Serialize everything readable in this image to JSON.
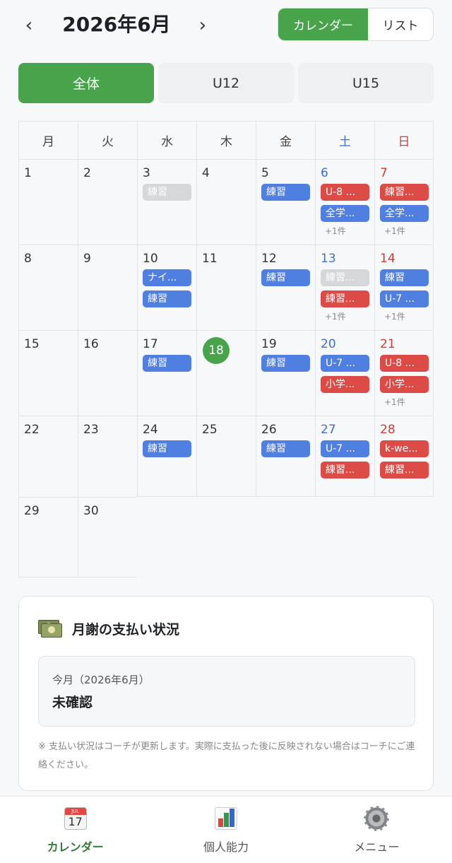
{
  "header": {
    "prev_symbol": "‹",
    "next_symbol": "›",
    "month_title": "2026年6月",
    "view_toggle": {
      "calendar": "カレンダー",
      "list": "リスト",
      "selected": "calendar"
    }
  },
  "tabs": [
    {
      "label": "全体",
      "active": true
    },
    {
      "label": "U12",
      "active": false
    },
    {
      "label": "U15",
      "active": false
    }
  ],
  "calendar": {
    "weekdays": [
      "月",
      "火",
      "水",
      "木",
      "金",
      "土",
      "日"
    ],
    "today": 18,
    "weeks": [
      [
        {
          "day": "1",
          "events": []
        },
        {
          "day": "2",
          "events": []
        },
        {
          "day": "3",
          "events": [
            {
              "label": "練習",
              "color": "gray"
            }
          ]
        },
        {
          "day": "4",
          "events": []
        },
        {
          "day": "5",
          "events": [
            {
              "label": "練習",
              "color": "blue"
            }
          ]
        },
        {
          "day": "6",
          "events": [
            {
              "label": "U-8 ...",
              "color": "red"
            },
            {
              "label": "全学...",
              "color": "blue"
            }
          ],
          "more": "+1件"
        },
        {
          "day": "7",
          "events": [
            {
              "label": "練習...",
              "color": "red"
            },
            {
              "label": "全学...",
              "color": "blue"
            }
          ],
          "more": "+1件"
        }
      ],
      [
        {
          "day": "8",
          "events": []
        },
        {
          "day": "9",
          "events": []
        },
        {
          "day": "10",
          "events": [
            {
              "label": "ナイ...",
              "color": "blue"
            },
            {
              "label": "練習",
              "color": "blue"
            }
          ]
        },
        {
          "day": "11",
          "events": []
        },
        {
          "day": "12",
          "events": [
            {
              "label": "練習",
              "color": "blue"
            }
          ]
        },
        {
          "day": "13",
          "events": [
            {
              "label": "練習...",
              "color": "gray"
            },
            {
              "label": "練習...",
              "color": "red"
            }
          ],
          "more": "+1件"
        },
        {
          "day": "14",
          "events": [
            {
              "label": "練習",
              "color": "blue"
            },
            {
              "label": "U-7 ...",
              "color": "blue"
            }
          ],
          "more": "+1件"
        }
      ],
      [
        {
          "day": "15",
          "events": []
        },
        {
          "day": "16",
          "events": []
        },
        {
          "day": "17",
          "events": [
            {
              "label": "練習",
              "color": "blue"
            }
          ]
        },
        {
          "day": "18",
          "events": [],
          "today": true
        },
        {
          "day": "19",
          "events": [
            {
              "label": "練習",
              "color": "blue"
            }
          ]
        },
        {
          "day": "20",
          "events": [
            {
              "label": "U-7 ...",
              "color": "blue"
            },
            {
              "label": "小学...",
              "color": "red"
            }
          ]
        },
        {
          "day": "21",
          "events": [
            {
              "label": "U-8 ...",
              "color": "red"
            },
            {
              "label": "小学...",
              "color": "red"
            }
          ],
          "more": "+1件"
        }
      ],
      [
        {
          "day": "22",
          "events": []
        },
        {
          "day": "23",
          "events": []
        },
        {
          "day": "24",
          "events": [
            {
              "label": "練習",
              "color": "blue"
            }
          ]
        },
        {
          "day": "25",
          "events": []
        },
        {
          "day": "26",
          "events": [
            {
              "label": "練習",
              "color": "blue"
            }
          ]
        },
        {
          "day": "27",
          "events": [
            {
              "label": "U-7 ...",
              "color": "blue"
            },
            {
              "label": "練習...",
              "color": "red"
            }
          ]
        },
        {
          "day": "28",
          "events": [
            {
              "label": "k-we...",
              "color": "red"
            },
            {
              "label": "練習...",
              "color": "red"
            }
          ]
        }
      ],
      [
        {
          "day": "29",
          "events": []
        },
        {
          "day": "30",
          "events": []
        }
      ]
    ]
  },
  "fee": {
    "icon": "money-icon",
    "title": "月謝の支払い状況",
    "month_label": "今月（2026年6月）",
    "status": "未確認",
    "note": "※ 支払い状況はコーチが更新します。実際に支払った後に反映されない場合はコーチにご連絡ください。"
  },
  "bottom_nav": [
    {
      "label": "カレンダー",
      "icon": "calendar-icon",
      "active": true,
      "icon_text": "17",
      "icon_month": "JUL"
    },
    {
      "label": "個人能力",
      "icon": "bar-chart-icon",
      "active": false
    },
    {
      "label": "メニュー",
      "icon": "gear-icon",
      "active": false
    }
  ],
  "colors": {
    "accent_green": "#47a44b",
    "event_blue": "#4f7fe0",
    "event_red": "#dc4b45",
    "event_gray": "#d5d7db",
    "saturday": "#3f6fd1",
    "sunday": "#d23c35"
  }
}
